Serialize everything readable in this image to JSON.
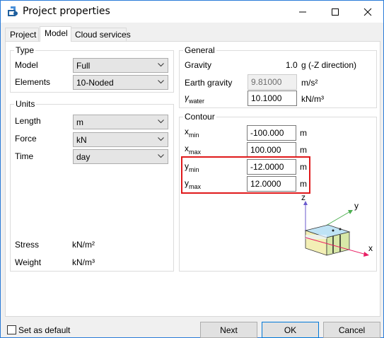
{
  "window": {
    "title": "Project properties",
    "icon": "app-icon",
    "controls": [
      "minimize-icon",
      "maximize-icon",
      "close-icon"
    ]
  },
  "tabs": [
    {
      "label": "Project",
      "active": false
    },
    {
      "label": "Model",
      "active": true
    },
    {
      "label": "Cloud services",
      "active": false
    }
  ],
  "type": {
    "legend": "Type",
    "model_label": "Model",
    "model_value": "Full",
    "elements_label": "Elements",
    "elements_value": "10-Noded"
  },
  "units": {
    "legend": "Units",
    "length_label": "Length",
    "length_value": "m",
    "force_label": "Force",
    "force_value": "kN",
    "time_label": "Time",
    "time_value": "day",
    "stress_label": "Stress",
    "stress_value": "kN/m²",
    "weight_label": "Weight",
    "weight_value": "kN/m³"
  },
  "general": {
    "legend": "General",
    "gravity_label": "Gravity",
    "gravity_value": "1.0",
    "gravity_unit": "g (-Z direction)",
    "earth_gravity_label": "Earth gravity",
    "earth_gravity_value": "9.81000",
    "earth_gravity_unit": "m/s²",
    "gamma_symbol": "γ",
    "gamma_sub": "water",
    "gamma_value": "10.1000",
    "gamma_unit": "kN/m³"
  },
  "contour": {
    "legend": "Contour",
    "rows": [
      {
        "base": "x",
        "sub": "min",
        "value": "-100.000",
        "unit": "m"
      },
      {
        "base": "x",
        "sub": "max",
        "value": "100.000",
        "unit": "m"
      },
      {
        "base": "y",
        "sub": "min",
        "value": "-12.0000",
        "unit": "m"
      },
      {
        "base": "y",
        "sub": "max",
        "value": "12.0000",
        "unit": "m"
      }
    ],
    "axis_z": "z",
    "axis_y": "y",
    "axis_x": "x"
  },
  "footer": {
    "set_default_label": "Set as default",
    "next_label": "Next",
    "ok_label": "OK",
    "cancel_label": "Cancel"
  },
  "colors": {
    "highlight": "#e0191b",
    "window_border": "#2a7bd8"
  }
}
